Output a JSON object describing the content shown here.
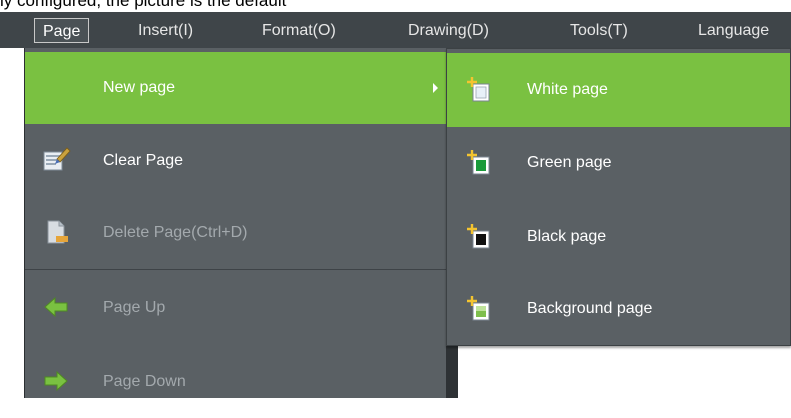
{
  "page_top_text": "ly configured, the picture is the default",
  "menubar": {
    "items": [
      {
        "label": "Page"
      },
      {
        "label": "Insert(I)"
      },
      {
        "label": "Format(O)"
      },
      {
        "label": "Drawing(D)"
      },
      {
        "label": "Tools(T)"
      },
      {
        "label": "Language"
      }
    ]
  },
  "page_menu": {
    "items": [
      {
        "label": "New page",
        "icon": "none",
        "enabled": true,
        "submenu": true
      },
      {
        "label": "Clear Page",
        "icon": "eraser-icon",
        "enabled": true
      },
      {
        "label": "Delete Page(Ctrl+D)",
        "icon": "delete-page-icon",
        "enabled": false
      },
      {
        "label": "Page Up",
        "icon": "arrow-left-icon",
        "enabled": false
      },
      {
        "label": "Page Down",
        "icon": "arrow-right-icon",
        "enabled": false
      }
    ]
  },
  "new_page_submenu": {
    "items": [
      {
        "label": "White page",
        "icon": "new-white-page-icon"
      },
      {
        "label": "Green page",
        "icon": "new-green-page-icon"
      },
      {
        "label": "Black page",
        "icon": "new-black-page-icon"
      },
      {
        "label": "Background page",
        "icon": "new-background-page-icon"
      }
    ]
  },
  "colors": {
    "menubar": "#3f4549",
    "menu_bg": "#5a6064",
    "highlight": "#7ac141",
    "disabled_text": "#a3a9ad"
  }
}
